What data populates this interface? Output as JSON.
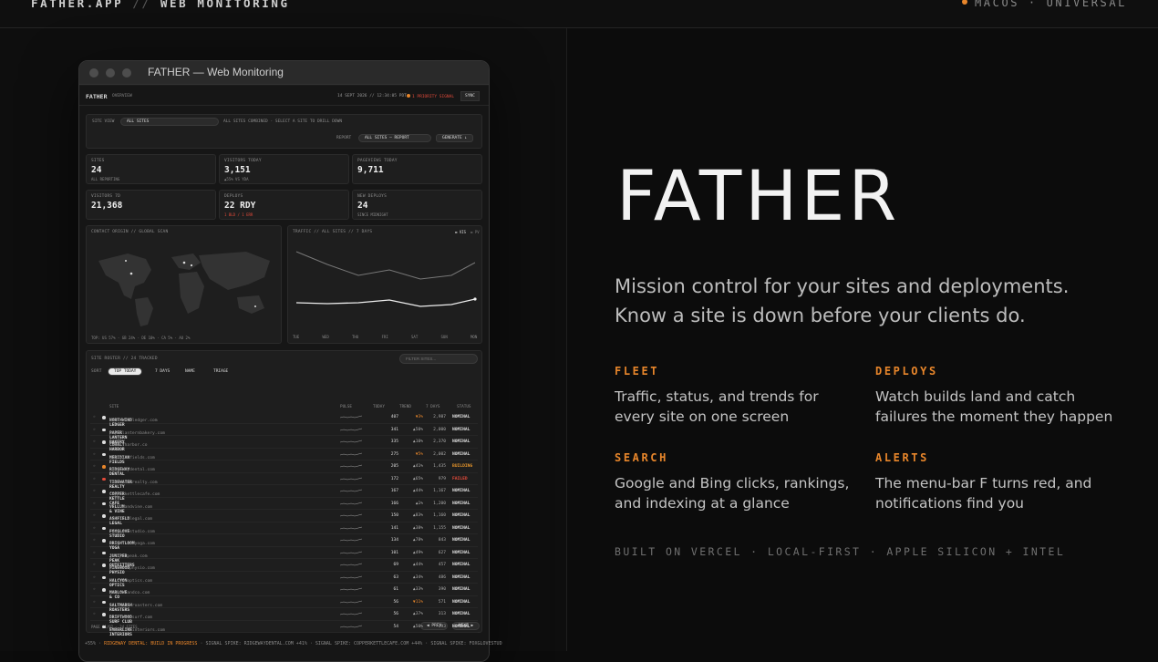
{
  "topbar": {
    "brand": "FATHER.APP",
    "sep": "//",
    "section": "WEB MONITORING",
    "platform": "MACOS · UNIVERSAL"
  },
  "colors": {
    "accent": "#e8862b",
    "alert": "#e24a3a",
    "bg": "#0c0c0c"
  },
  "window": {
    "title": "FATHER — Web Monitoring"
  },
  "app": {
    "logo": "FATHER",
    "view": "OVERVIEW",
    "date": "14 SEPT 2026 // 12:34:05 PDT",
    "signal": "1 PRIORITY SIGNAL",
    "sync": "SYNC",
    "site_view_label": "SITE VIEW",
    "site_view_value": "ALL SITES",
    "site_view_hint": "ALL SITES COMBINED · SELECT A SITE TO DRILL DOWN",
    "report_label": "REPORT",
    "report_value": "ALL SITES — REPORT",
    "generate": "GENERATE ↓",
    "stats": [
      {
        "label": "SITES",
        "value": "24",
        "sub": "ALL REPORTING"
      },
      {
        "label": "VISITORS TODAY",
        "value": "3,151",
        "sub": "▲55% VS YDA"
      },
      {
        "label": "PAGEVIEWS TODAY",
        "value": "9,711",
        "sub": ""
      },
      {
        "label": "VISITORS 7D",
        "value": "21,368",
        "sub": ""
      },
      {
        "label": "DEPLOYS",
        "value": "22 RDY",
        "sub": "1 BLD / 1 ERR"
      },
      {
        "label": "NEW DEPLOYS",
        "value": "24",
        "sub": "SINCE MIDNIGHT"
      }
    ],
    "map": {
      "title": "CONTACT ORIGIN // GLOBAL SCAN",
      "footer": "TOP: US 57% · GB 24% · DE 10% · CA 5% · AU 2%"
    },
    "traffic": {
      "title": "TRAFFIC // ALL SITES // 7 DAYS",
      "legend_vis": "VIS",
      "legend_pv": "PV",
      "days": [
        "TUE",
        "WED",
        "THU",
        "FRI",
        "SAT",
        "SUN",
        "MON"
      ]
    },
    "roster": {
      "title": "SITE ROSTER // 24 TRACKED",
      "filter_placeholder": "FILTER SITES...",
      "sort_label": "SORT",
      "sorts": [
        "TOP TODAY",
        "7 DAYS",
        "NAME",
        "TRIAGE"
      ],
      "cols": {
        "site": "SITE",
        "pulse": "PULSE",
        "today": "TODAY",
        "trend": "TREND",
        "d7": "7 DAYS",
        "status": "STATUS"
      },
      "rows": [
        {
          "name": "NORTHWIND LEDGER",
          "domain": "northwindledger.com",
          "today": "407",
          "trend": "▼3%",
          "dir": "down",
          "d7": "2,987",
          "status": "NOMINAL",
          "dot": "#dddddd"
        },
        {
          "name": "PAPER LANTERN BAKERY",
          "domain": "paperlanternbakery.com",
          "today": "341",
          "trend": "▲50%",
          "dir": "up",
          "d7": "2,000",
          "status": "NOMINAL",
          "dot": "#dddddd"
        },
        {
          "name": "COBALT HARBOR",
          "domain": "cobaltharbor.co",
          "today": "335",
          "trend": "▲10%",
          "dir": "up",
          "d7": "2,370",
          "status": "NOMINAL",
          "dot": "#dddddd"
        },
        {
          "name": "MERIDIAN FIELDS",
          "domain": "meridianfields.com",
          "today": "275",
          "trend": "▼5%",
          "dir": "down",
          "d7": "2,002",
          "status": "NOMINAL",
          "dot": "#dddddd"
        },
        {
          "name": "RIDGEWAY DENTAL",
          "domain": "ridgewaydental.com",
          "today": "205",
          "trend": "▲41%",
          "dir": "up",
          "d7": "1,435",
          "status": "BUILDING",
          "dot": "#e8862b"
        },
        {
          "name": "TIDEWATER REALTY",
          "domain": "tidewaterrealty.com",
          "today": "172",
          "trend": "▲65%",
          "dir": "up",
          "d7": "979",
          "status": "FAILED",
          "dot": "#e24a3a"
        },
        {
          "name": "COPPER KETTLE CAFE",
          "domain": "copperkettlecafe.com",
          "today": "167",
          "trend": "▲44%",
          "dir": "up",
          "d7": "1,167",
          "status": "NOMINAL",
          "dot": "#dddddd"
        },
        {
          "name": "VELLUM & VINE",
          "domain": "vellumandvine.com",
          "today": "166",
          "trend": "▲1%",
          "dir": "up",
          "d7": "1,200",
          "status": "NOMINAL",
          "dot": "#dddddd"
        },
        {
          "name": "ASHFIELD LEGAL",
          "domain": "ashfieldlegal.com",
          "today": "150",
          "trend": "▲83%",
          "dir": "up",
          "d7": "1,160",
          "status": "NOMINAL",
          "dot": "#dddddd"
        },
        {
          "name": "FOXGLOVE STUDIO",
          "domain": "foxglovestudio.com",
          "today": "141",
          "trend": "▲38%",
          "dir": "up",
          "d7": "1,155",
          "status": "NOMINAL",
          "dot": "#dddddd"
        },
        {
          "name": "BRIGHTLOOM YOGA",
          "domain": "brightloomyoga.com",
          "today": "134",
          "trend": "▲78%",
          "dir": "up",
          "d7": "843",
          "status": "NOMINAL",
          "dot": "#dddddd"
        },
        {
          "name": "JUNIPER PEAK OUTFITTERS",
          "domain": "juniperpeak.com",
          "today": "101",
          "trend": "▲49%",
          "dir": "up",
          "d7": "627",
          "status": "NOMINAL",
          "dot": "#dddddd"
        },
        {
          "name": "PINEWOOD PHYSIO",
          "domain": "pinewoodphysio.com",
          "today": "69",
          "trend": "▲44%",
          "dir": "up",
          "d7": "457",
          "status": "NOMINAL",
          "dot": "#dddddd"
        },
        {
          "name": "HALCYON OPTICS",
          "domain": "halcyonoptics.com",
          "today": "63",
          "trend": "▲34%",
          "dir": "up",
          "d7": "486",
          "status": "NOMINAL",
          "dot": "#dddddd"
        },
        {
          "name": "MARLOWE & CO",
          "domain": "marloweandco.com",
          "today": "61",
          "trend": "▲33%",
          "dir": "up",
          "d7": "390",
          "status": "NOMINAL",
          "dot": "#dddddd"
        },
        {
          "name": "SALTMARSH ROASTERS",
          "domain": "saltmarshroasters.com",
          "today": "56",
          "trend": "▼11%",
          "dir": "down",
          "d7": "571",
          "status": "NOMINAL",
          "dot": "#dddddd"
        },
        {
          "name": "DRIFTWOOD SURF CLUB",
          "domain": "driftwoodsurf.com",
          "today": "56",
          "trend": "▲37%",
          "dir": "up",
          "d7": "313",
          "status": "NOMINAL",
          "dot": "#dddddd"
        },
        {
          "name": "EMBERLINE INTERIORS",
          "domain": "emberlineinteriors.com",
          "today": "54",
          "trend": "▲50%",
          "dir": "up",
          "d7": "393",
          "status": "NOMINAL",
          "dot": "#dddddd"
        }
      ],
      "page": "PAGE 01/02 · 24 SITES",
      "prev": "◀ PREV",
      "next": "NEXT ▶"
    },
    "ticker": {
      "pre": "+55% ·",
      "highlight": "RIDGEWAY DENTAL: BUILD IN PROGRESS",
      "rest": "· SIGNAL SPIKE: RIDGEWAYDENTAL.COM +41% · SIGNAL SPIKE: COPPERKETTLECAFE.COM +44% · SIGNAL SPIKE: FOXGLOVESTUD"
    }
  },
  "hero": {
    "title": "FATHER",
    "tagline": "Mission control for your sites and deployments. Know a site is down before your clients do."
  },
  "features": [
    {
      "heading": "FLEET",
      "text": "Traffic, status, and trends for every site on one screen"
    },
    {
      "heading": "DEPLOYS",
      "text": "Watch builds land and catch failures the moment they happen"
    },
    {
      "heading": "SEARCH",
      "text": "Google and Bing clicks, rankings, and indexing at a glance"
    },
    {
      "heading": "ALERTS",
      "text": "The menu-bar F turns red, and notifications find you"
    }
  ],
  "built": "BUILT ON VERCEL · LOCAL-FIRST · APPLE SILICON + INTEL"
}
